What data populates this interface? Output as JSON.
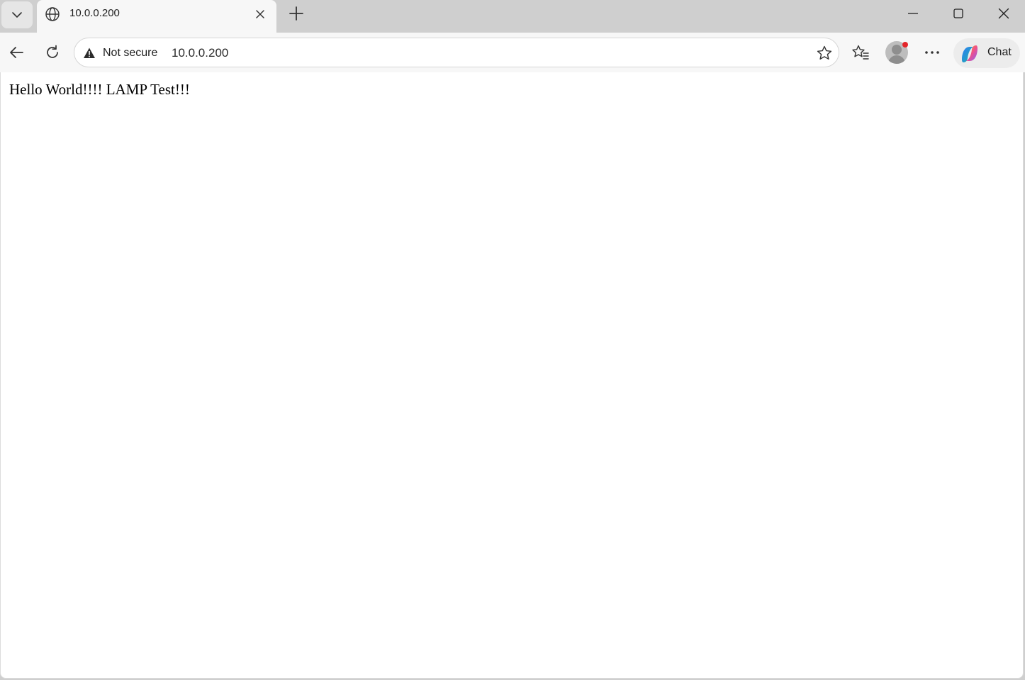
{
  "tab": {
    "title": "10.0.0.200"
  },
  "omnibox": {
    "security_label": "Not secure",
    "url": "10.0.0.200"
  },
  "toolbar": {
    "chat_label": "Chat"
  },
  "page": {
    "body_text": "Hello World!!!! LAMP Test!!!"
  },
  "icons": {
    "tab_list": "chevron-down-icon",
    "favicon": "globe-icon",
    "tab_close": "close-icon",
    "new_tab": "plus-icon",
    "minimize": "minimize-icon",
    "maximize": "maximize-icon",
    "window_close": "close-icon",
    "back": "back-arrow-icon",
    "reload": "reload-icon",
    "security": "warning-icon",
    "favorite": "star-icon",
    "favorites": "favorites-icon",
    "profile": "profile-avatar-icon",
    "more": "more-icon",
    "copilot": "copilot-icon"
  },
  "colors": {
    "frame": "#cfcfcf",
    "toolbar": "#f7f7f7",
    "notification_dot": "#e3262b"
  }
}
